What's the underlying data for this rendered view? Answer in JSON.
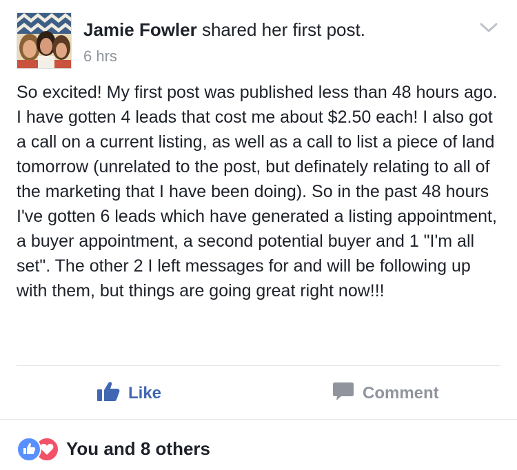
{
  "post": {
    "author": "Jamie Fowler",
    "action_text": " shared her first post.",
    "timestamp": "6 hrs",
    "body": "So excited!  My first post was published less than 48 hours ago.  I have gotten 4 leads that cost me about $2.50 each!  I also got a call on a current listing, as well as a call to list a piece of land tomorrow (unrelated to the post, but definately relating to all of the marketing that I have been doing).  So in the past 48 hours I've gotten 6 leads which have generated a listing appointment, a buyer appointment, a second potential buyer and 1 \"I'm all set\".  The other 2 I left messages for and will be following up with them, but things are going great right now!!!"
  },
  "actions": {
    "like_label": "Like",
    "comment_label": "Comment"
  },
  "reactions": {
    "summary": "You and 8 others",
    "types": [
      "like-icon",
      "love-icon"
    ]
  },
  "icons": {
    "menu": "chevron-down-icon",
    "like": "thumbs-up-icon",
    "comment": "comment-bubble-icon"
  },
  "colors": {
    "like_blue": "#4267b2",
    "muted_gray": "#90949c",
    "text": "#1d2129",
    "love_red": "#f25268",
    "reaction_blue": "#5890ff"
  }
}
